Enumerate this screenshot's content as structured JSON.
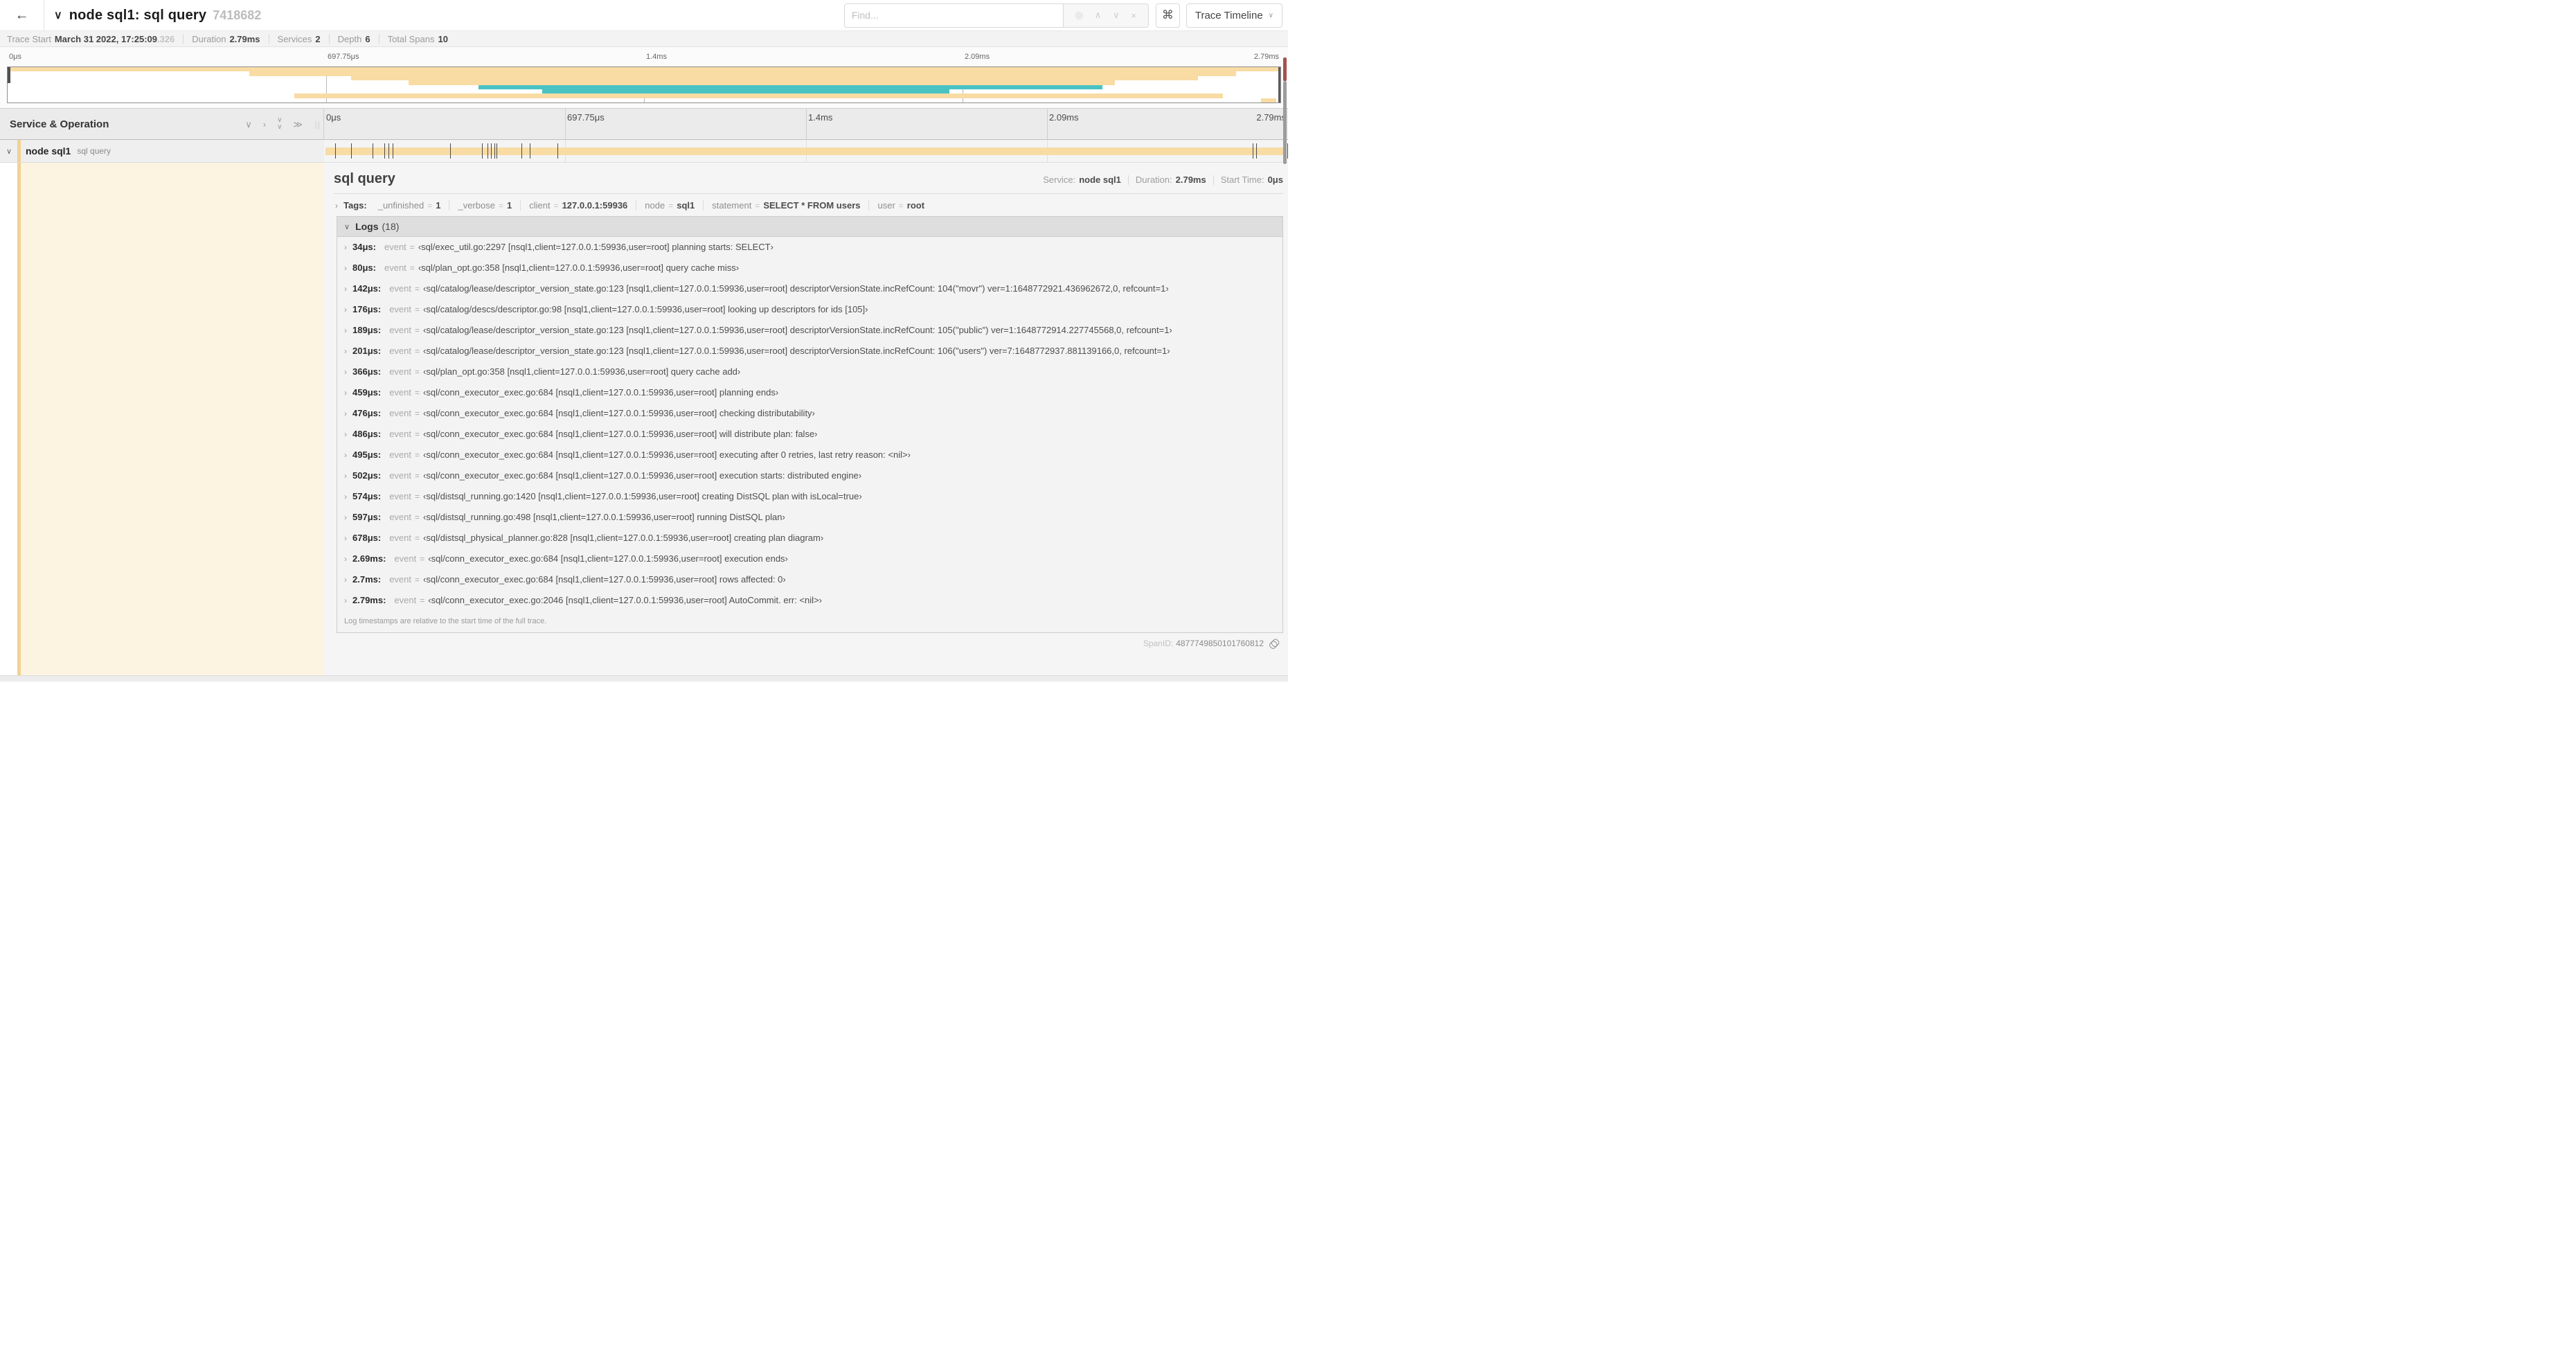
{
  "icons": {
    "back": "←",
    "chevron_down": "∨",
    "chevron_up": "∧",
    "chevron_right": "›",
    "double_right": "≫",
    "command": "⌘",
    "target": "◎",
    "close": "×",
    "grip": "||"
  },
  "colors": {
    "span_orange": "#f8dca4",
    "span_teal": "#49c3c2",
    "accent_orange": "#f2d194"
  },
  "header": {
    "title": "node sql1: sql query",
    "trace_id": "7418682",
    "find_placeholder": "Find...",
    "view_button": "Trace Timeline"
  },
  "trace_meta": {
    "items": [
      {
        "label": "Trace Start",
        "value": "March 31 2022, 17:25:09",
        "muted_suffix": ".326"
      },
      {
        "label": "Duration",
        "value": "2.79ms"
      },
      {
        "label": "Services",
        "value": "2"
      },
      {
        "label": "Depth",
        "value": "6"
      },
      {
        "label": "Total Spans",
        "value": "10"
      }
    ]
  },
  "minimap": {
    "ticks": [
      {
        "label": "0μs",
        "pct": 0
      },
      {
        "label": "697.75μs",
        "pct": 25
      },
      {
        "label": "1.4ms",
        "pct": 50
      },
      {
        "label": "2.09ms",
        "pct": 75
      },
      {
        "label": "2.79ms",
        "pct": 100
      }
    ],
    "gridlines_pct": [
      25,
      50,
      75
    ],
    "spans": [
      {
        "start": 0,
        "end": 100,
        "color": "orange"
      },
      {
        "start": 19,
        "end": 96.5,
        "color": "orange"
      },
      {
        "start": 27,
        "end": 93.5,
        "color": "orange"
      },
      {
        "start": 31.5,
        "end": 87,
        "color": "orange"
      },
      {
        "start": 37,
        "end": 86,
        "color": "teal"
      },
      {
        "start": 42,
        "end": 74,
        "color": "teal"
      },
      {
        "start": 22.5,
        "end": 95.5,
        "color": "orange"
      },
      {
        "start": 98.5,
        "end": 99.7,
        "color": "orange"
      }
    ]
  },
  "timeline_header": {
    "left_title": "Service & Operation",
    "ticks": [
      {
        "label": "0μs",
        "pct": 0
      },
      {
        "label": "697.75μs",
        "pct": 25
      },
      {
        "label": "1.4ms",
        "pct": 50
      },
      {
        "label": "2.09ms",
        "pct": 75
      },
      {
        "label": "2.79ms",
        "pct": 100
      }
    ],
    "gridlines_pct": [
      25,
      50,
      75
    ]
  },
  "span_row": {
    "service": "node sql1",
    "operation": "sql query",
    "bar_color": "orange",
    "log_marker_pcts": [
      1.22,
      2.87,
      5.09,
      6.31,
      6.77,
      7.2,
      13.12,
      16.45,
      17.06,
      17.42,
      17.74,
      17.99,
      20.57,
      21.4,
      24.3,
      96.42,
      96.77,
      100
    ]
  },
  "detail": {
    "title": "sql query",
    "eq_sign": "=",
    "meta": [
      {
        "label": "Service:",
        "value": "node sql1"
      },
      {
        "label": "Duration:",
        "value": "2.79ms"
      },
      {
        "label": "Start Time:",
        "value": "0μs"
      }
    ],
    "tags_label": "Tags:",
    "tags": [
      {
        "key": "_unfinished",
        "value": "1"
      },
      {
        "key": "_verbose",
        "value": "1"
      },
      {
        "key": "client",
        "value": "127.0.0.1:59936"
      },
      {
        "key": "node",
        "value": "sql1"
      },
      {
        "key": "statement",
        "value": "SELECT * FROM users"
      },
      {
        "key": "user",
        "value": "root"
      }
    ],
    "logs_label": "Logs",
    "logs_count": "(18)",
    "logs": [
      {
        "time": "34μs:",
        "field": "event",
        "value": "‹sql/exec_util.go:2297 [nsql1,client=127.0.0.1:59936,user=root] planning starts: SELECT›"
      },
      {
        "time": "80μs:",
        "field": "event",
        "value": "‹sql/plan_opt.go:358 [nsql1,client=127.0.0.1:59936,user=root] query cache miss›"
      },
      {
        "time": "142μs:",
        "field": "event",
        "value": "‹sql/catalog/lease/descriptor_version_state.go:123 [nsql1,client=127.0.0.1:59936,user=root] descriptorVersionState.incRefCount: 104(\"movr\") ver=1:1648772921.436962672,0, refcount=1›"
      },
      {
        "time": "176μs:",
        "field": "event",
        "value": "‹sql/catalog/descs/descriptor.go:98 [nsql1,client=127.0.0.1:59936,user=root] looking up descriptors for ids [105]›"
      },
      {
        "time": "189μs:",
        "field": "event",
        "value": "‹sql/catalog/lease/descriptor_version_state.go:123 [nsql1,client=127.0.0.1:59936,user=root] descriptorVersionState.incRefCount: 105(\"public\") ver=1:1648772914.227745568,0, refcount=1›"
      },
      {
        "time": "201μs:",
        "field": "event",
        "value": "‹sql/catalog/lease/descriptor_version_state.go:123 [nsql1,client=127.0.0.1:59936,user=root] descriptorVersionState.incRefCount: 106(\"users\") ver=7:1648772937.881139166,0, refcount=1›"
      },
      {
        "time": "366μs:",
        "field": "event",
        "value": "‹sql/plan_opt.go:358 [nsql1,client=127.0.0.1:59936,user=root] query cache add›"
      },
      {
        "time": "459μs:",
        "field": "event",
        "value": "‹sql/conn_executor_exec.go:684 [nsql1,client=127.0.0.1:59936,user=root] planning ends›"
      },
      {
        "time": "476μs:",
        "field": "event",
        "value": "‹sql/conn_executor_exec.go:684 [nsql1,client=127.0.0.1:59936,user=root] checking distributability›"
      },
      {
        "time": "486μs:",
        "field": "event",
        "value": "‹sql/conn_executor_exec.go:684 [nsql1,client=127.0.0.1:59936,user=root] will distribute plan: false›"
      },
      {
        "time": "495μs:",
        "field": "event",
        "value": "‹sql/conn_executor_exec.go:684 [nsql1,client=127.0.0.1:59936,user=root] executing after 0 retries, last retry reason: <nil>›"
      },
      {
        "time": "502μs:",
        "field": "event",
        "value": "‹sql/conn_executor_exec.go:684 [nsql1,client=127.0.0.1:59936,user=root] execution starts: distributed engine›"
      },
      {
        "time": "574μs:",
        "field": "event",
        "value": "‹sql/distsql_running.go:1420 [nsql1,client=127.0.0.1:59936,user=root] creating DistSQL plan with isLocal=true›"
      },
      {
        "time": "597μs:",
        "field": "event",
        "value": "‹sql/distsql_running.go:498 [nsql1,client=127.0.0.1:59936,user=root] running DistSQL plan›"
      },
      {
        "time": "678μs:",
        "field": "event",
        "value": "‹sql/distsql_physical_planner.go:828 [nsql1,client=127.0.0.1:59936,user=root] creating plan diagram›"
      },
      {
        "time": "2.69ms:",
        "field": "event",
        "value": "‹sql/conn_executor_exec.go:684 [nsql1,client=127.0.0.1:59936,user=root] execution ends›"
      },
      {
        "time": "2.7ms:",
        "field": "event",
        "value": "‹sql/conn_executor_exec.go:684 [nsql1,client=127.0.0.1:59936,user=root] rows affected: 0›"
      },
      {
        "time": "2.79ms:",
        "field": "event",
        "value": "‹sql/conn_executor_exec.go:2046 [nsql1,client=127.0.0.1:59936,user=root] AutoCommit. err: <nil>›"
      }
    ],
    "logs_footnote": "Log timestamps are relative to the start time of the full trace.",
    "span_id_label": "SpanID:",
    "span_id": "4877749850101760812"
  }
}
